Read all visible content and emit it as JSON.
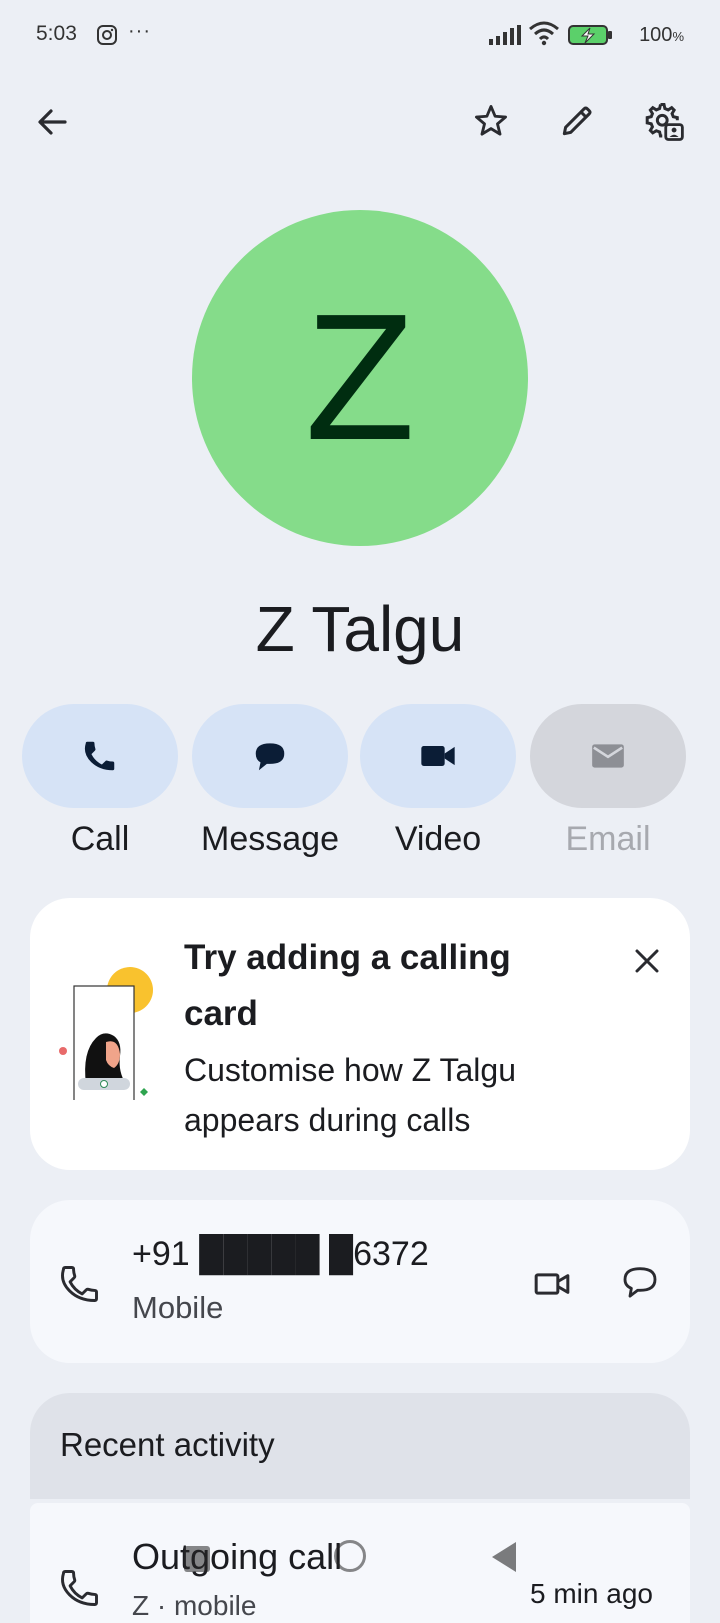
{
  "status_bar": {
    "time": "5:03",
    "more": "···",
    "battery": "100",
    "battery_unit": "%",
    "icons": [
      "instagram-icon",
      "signal-icon",
      "wifi-icon",
      "battery-charging-icon"
    ]
  },
  "toolbar": {
    "back_icon": "arrow-left-icon",
    "favorite_icon": "star-outline-icon",
    "edit_icon": "pencil-icon",
    "settings_icon": "contact-settings-icon"
  },
  "contact": {
    "initial": "Z",
    "name": "Z Talgu",
    "avatar_color": "#85dc8a"
  },
  "actions": [
    {
      "label": "Call",
      "icon": "phone-icon",
      "enabled": true
    },
    {
      "label": "Message",
      "icon": "message-icon",
      "enabled": true
    },
    {
      "label": "Video",
      "icon": "video-icon",
      "enabled": true
    },
    {
      "label": "Email",
      "icon": "email-icon",
      "enabled": false
    }
  ],
  "promo": {
    "title": "Try adding a calling card",
    "subtitle": "Customise how Z Talgu appears during calls",
    "close_icon": "close-icon"
  },
  "phone": {
    "number": "+91 █████ █6372",
    "type": "Mobile",
    "icons": [
      "phone-outline-icon",
      "video-outline-icon",
      "message-outline-icon"
    ]
  },
  "recent": {
    "title": "Recent activity",
    "items": [
      {
        "type": "Outgoing call",
        "sub": "Z · mobile",
        "time": "5 min ago"
      }
    ]
  },
  "colors": {
    "background": "#eceff5",
    "action_bg": "#d6e3f6",
    "action_disabled_bg": "#d4d6dc",
    "card_bg": "#ffffff",
    "avatar_text": "#002d10"
  }
}
